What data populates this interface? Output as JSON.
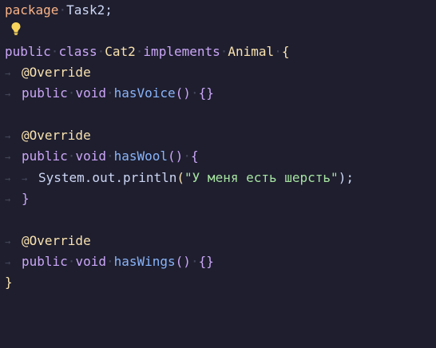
{
  "code": {
    "package_kw": "package",
    "package_name": "Task2;",
    "class_line": {
      "public": "public",
      "class": "class",
      "name": "Cat2",
      "implements": "implements",
      "iface": "Animal",
      "open": "{"
    },
    "override": "@Override",
    "public": "public",
    "void": "void",
    "m1": "hasVoice",
    "m2": "hasWool",
    "m3": "hasWings",
    "parens": "()",
    "empty_body": "{}",
    "open_brace": "{",
    "close_brace": "}",
    "sysout": "System.out.println",
    "string": "\"У меня есть шерсть\"",
    "tail": ");"
  },
  "colors": {
    "background": "#1e1e2e",
    "keyword": "#cba6f7",
    "package": "#fab387",
    "class": "#f9e2af",
    "function": "#89b4fa",
    "string": "#a6e3a1",
    "text": "#cdd6f4"
  }
}
